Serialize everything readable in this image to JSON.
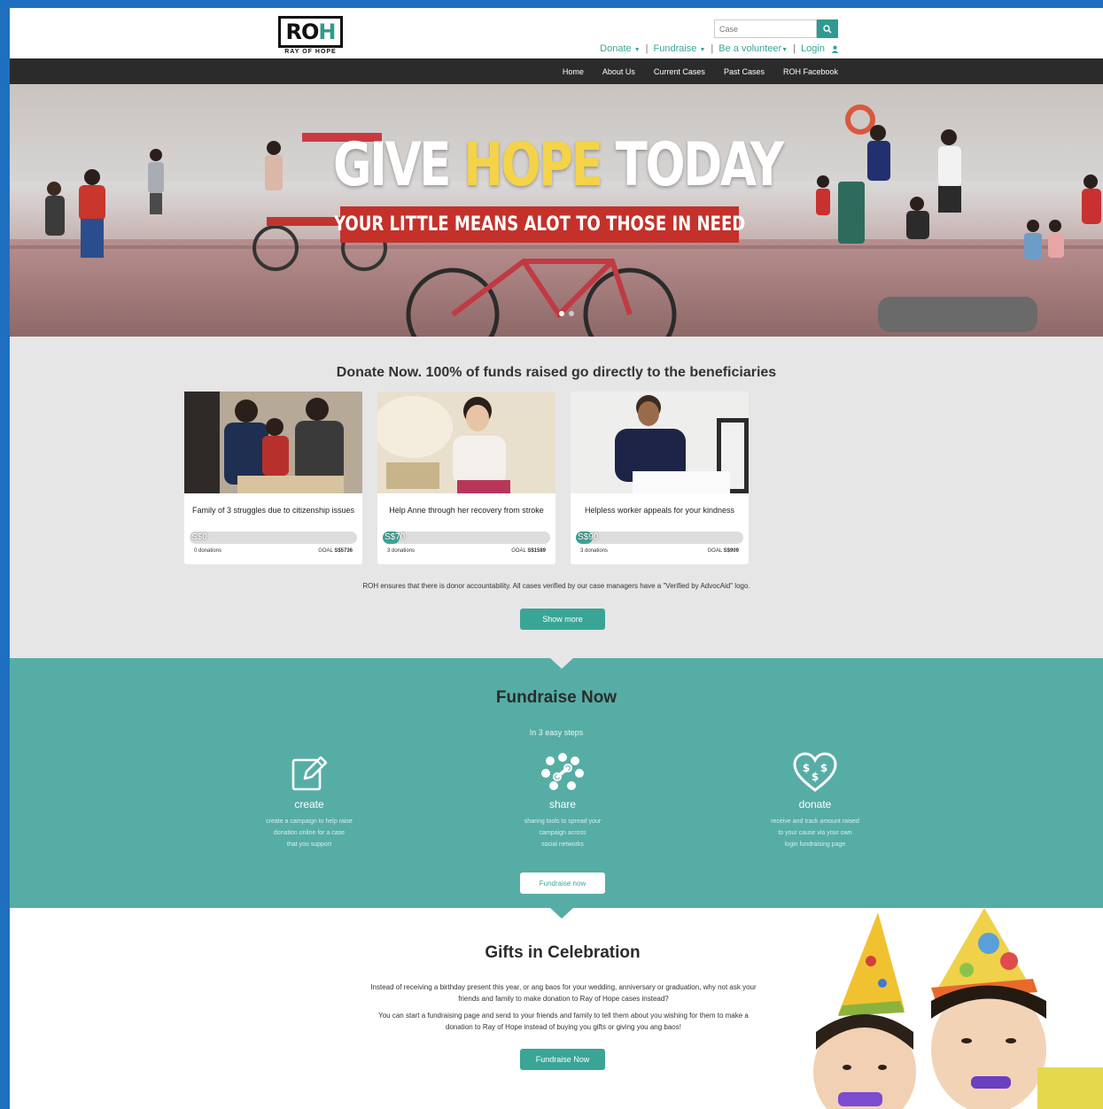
{
  "logo": {
    "mark": "ROH",
    "tagline": "RAY OF HOPE"
  },
  "search": {
    "placeholder": "Case",
    "button_icon": "search-icon"
  },
  "toplinks": {
    "donate": "Donate",
    "fundraise": "Fundraise",
    "volunteer": "Be a volunteer",
    "login": "Login",
    "login_icon": "user-icon"
  },
  "nav": [
    "Home",
    "About Us",
    "Current Cases",
    "Past Cases",
    "ROH Facebook"
  ],
  "hero": {
    "title_a": "GIVE ",
    "title_b": "HOPE",
    "title_c": " TODAY",
    "banner": "YOUR LITTLE MEANS ALOT TO THOSE IN NEED",
    "slides": 2,
    "active_slide": 1
  },
  "donate": {
    "title": "Donate Now. 100% of funds raised go directly to the beneficiaries",
    "cases": [
      {
        "title": "Family of 3 struggles due to citizenship issues",
        "amount": "S$0",
        "donations": "0 donations",
        "goal_label": "GOAL",
        "goal": "S$5736",
        "progress": 0
      },
      {
        "title": "Help Anne through her recovery from stroke",
        "amount": "S$70",
        "donations": "3 donations",
        "goal_label": "GOAL",
        "goal": "S$1589",
        "progress": 0.04
      },
      {
        "title": "Helpless worker appeals for your kindness",
        "amount": "S$90",
        "donations": "3 donations",
        "goal_label": "GOAL",
        "goal": "S$909",
        "progress": 0.1
      }
    ],
    "note": "ROH ensures that there is donor accountability. All cases verified by our case managers have a \"Verified by AdvocAid\" logo.",
    "show_more": "Show more"
  },
  "fundraise": {
    "title": "Fundraise Now",
    "subtitle": "In 3 easy steps",
    "steps": [
      {
        "icon": "edit-icon",
        "label": "create",
        "desc": [
          "create a campaign to help raise",
          "donation online for a case",
          "that you support"
        ]
      },
      {
        "icon": "share-icon",
        "label": "share",
        "desc": [
          "sharing tools to spread your",
          "campaign across",
          "social networks"
        ]
      },
      {
        "icon": "heart-donate-icon",
        "label": "donate",
        "desc": [
          "receive and track amount raised",
          "to your cause via your own",
          "login fundraising page"
        ]
      }
    ],
    "button": "Fundraise now"
  },
  "gifts": {
    "title": "Gifts in Celebration",
    "p1": "Instead of receiving a birthday present this year, or ang baos for your wedding, anniversary or graduation, why not ask your friends and family to make donation to Ray of Hope cases instead?",
    "p2": "You can start a fundraising page and send to your friends and family to tell them about you wishing for them to make a donation to Ray of Hope instead of buying you gifts or giving you ang baos!",
    "button": "Fundraise Now"
  },
  "colors": {
    "teal": "#3aa597",
    "teal_section": "#56ada5",
    "nav_bg": "#2b2b2b",
    "banner_red": "#c4312b",
    "hope_yellow": "#f4d348"
  }
}
